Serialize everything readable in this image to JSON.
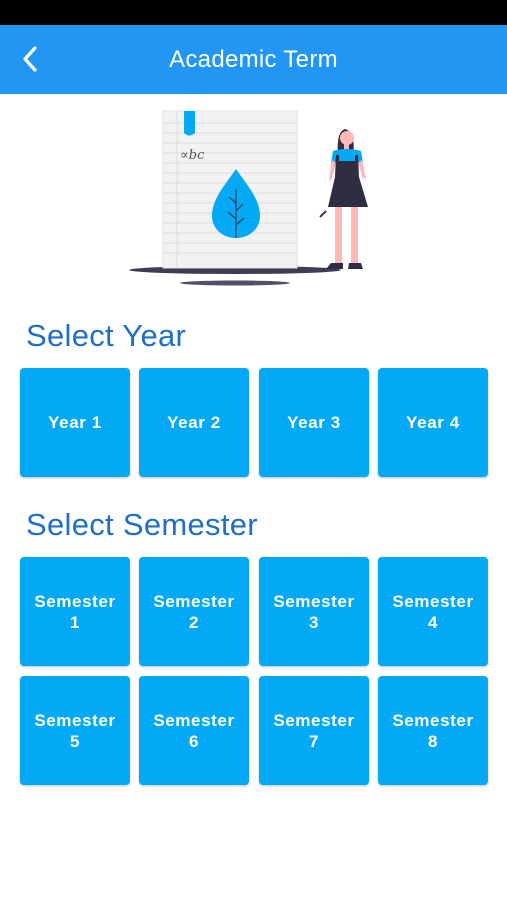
{
  "app_bar": {
    "title": "Academic Term"
  },
  "illustration": {
    "note_text": "∝bc",
    "accent_color": "#03a9f4"
  },
  "year_section": {
    "title": "Select Year",
    "items": [
      "Year 1",
      "Year 2",
      "Year 3",
      "Year 4"
    ]
  },
  "semester_section": {
    "title": "Select Semester",
    "items": [
      {
        "line1": "Semester",
        "line2": "1"
      },
      {
        "line1": "Semester",
        "line2": "2"
      },
      {
        "line1": "Semester",
        "line2": "3"
      },
      {
        "line1": "Semester",
        "line2": "4"
      },
      {
        "line1": "Semester",
        "line2": "5"
      },
      {
        "line1": "Semester",
        "line2": "6"
      },
      {
        "line1": "Semester",
        "line2": "7"
      },
      {
        "line1": "Semester",
        "line2": "8"
      }
    ]
  },
  "colors": {
    "app_bar": "#2196f3",
    "tile": "#03a9f4",
    "heading": "#1e6fc8"
  }
}
